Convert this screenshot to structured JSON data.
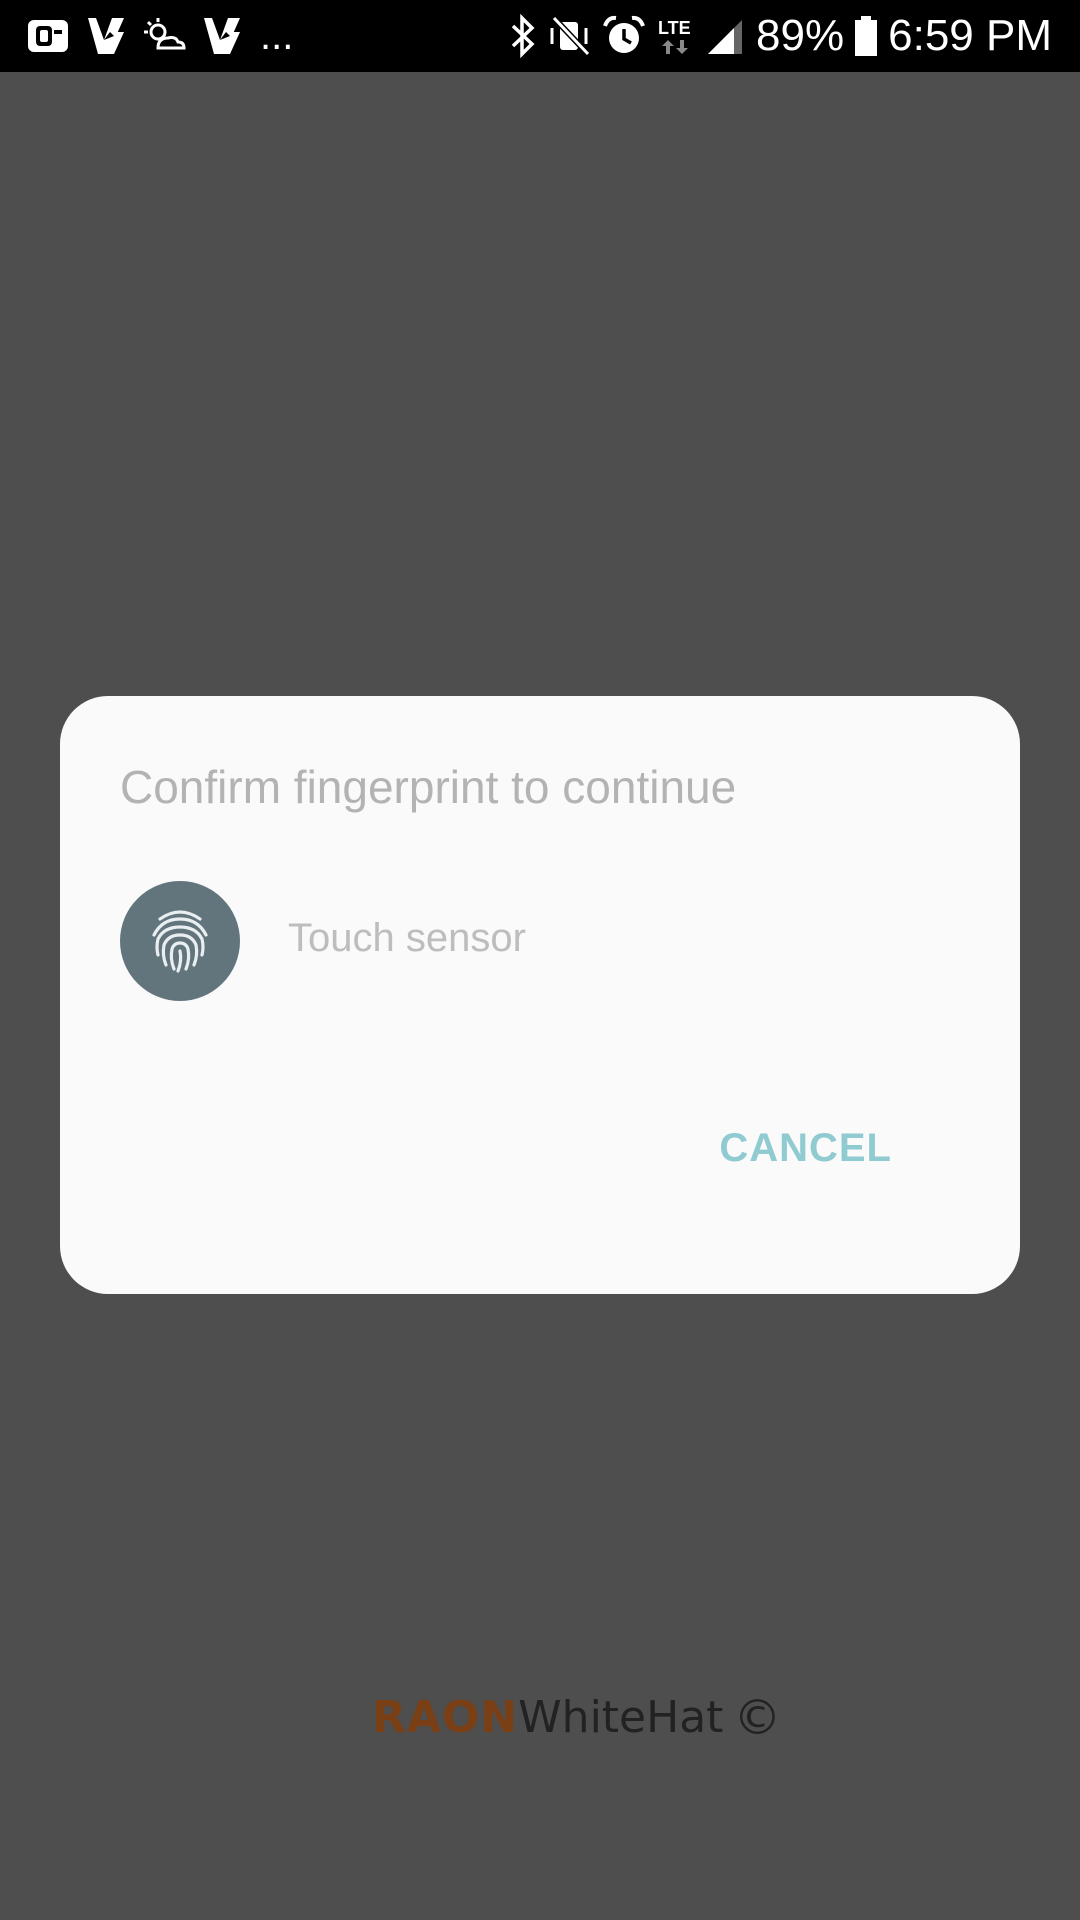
{
  "status_bar": {
    "left_icons": [
      "outlook-icon",
      "voicemail-icon",
      "weather-icon",
      "voicemail-icon",
      "more-dots-icon"
    ],
    "more_indicator": "...",
    "right_icons": [
      "bluetooth-icon",
      "vibrate-icon",
      "alarm-icon",
      "lte-icon",
      "signal-icon"
    ],
    "lte_label": "LTE",
    "battery_percent": "89%",
    "battery_level": 0.89,
    "time": "6:59 PM"
  },
  "dialog": {
    "title": "Confirm fingerprint to continue",
    "sensor_icon": "fingerprint-icon",
    "sensor_label": "Touch sensor",
    "cancel_label": "CANCEL"
  },
  "watermark": {
    "brand_part1": "RAON",
    "brand_part2": "WhiteHat",
    "copyright": "©"
  },
  "colors": {
    "background_scrim": "#4e4e4e",
    "dialog_bg": "#fafafa",
    "accent": "#8fcbd0",
    "fingerprint_circle": "#62757d"
  }
}
